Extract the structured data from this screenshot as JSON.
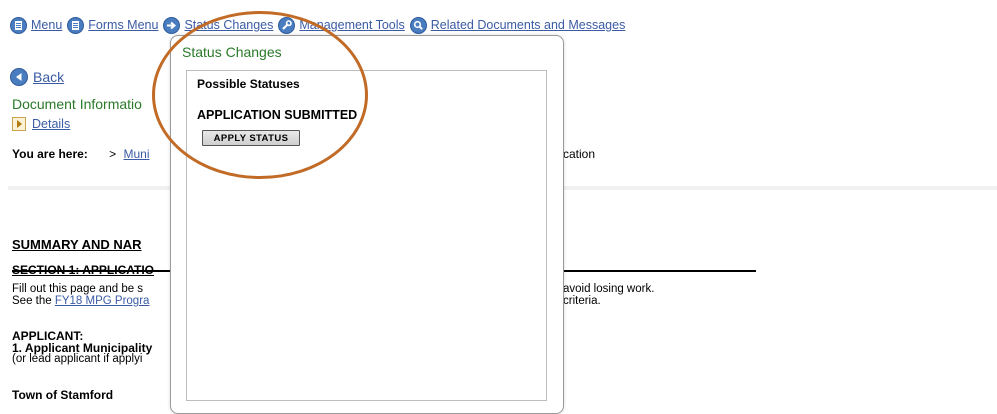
{
  "nav": {
    "menu": "Menu",
    "forms_menu": "Forms Menu",
    "status_changes": "Status Changes",
    "management_tools": "Management Tools",
    "related": "Related Documents and Messages"
  },
  "page": {
    "back": "Back",
    "doc_info": "Document Informatio",
    "details": "Details",
    "you_are_here": "You are here:",
    "crumb_sep": ">",
    "crumb_link": "Muni",
    "crumb_tail": "cation",
    "summary": "SUMMARY AND NAR",
    "section1": "SECTION 1: APPLICATIO",
    "fill_line1": "Fill out this page and be s",
    "fill_line2_prefix": "See the ",
    "fill_line2_link": "FY18 MPG Progra",
    "fill_right1": "avoid losing work.",
    "fill_right2": "criteria.",
    "applicant": "APPLICANT:",
    "applicant_muni": "1. Applicant Municipality",
    "lead": "(or lead applicant if applyi",
    "town": "Town of Stamford"
  },
  "modal": {
    "title": "Status Changes",
    "possible": "Possible Statuses",
    "status_name": "APPLICATION SUBMITTED",
    "apply_button": "APPLY STATUS"
  },
  "colors": {
    "link": "#3b5ba5",
    "heading_green": "#2a7a2a",
    "highlight_circle": "#c26b26"
  },
  "icons": {
    "menu": "document-icon",
    "forms_menu": "document-icon",
    "status_changes": "arrow-right-icon",
    "management_tools": "wrench-icon",
    "related": "magnifier-icon",
    "back": "back-arrow-icon",
    "details": "expand-icon"
  }
}
